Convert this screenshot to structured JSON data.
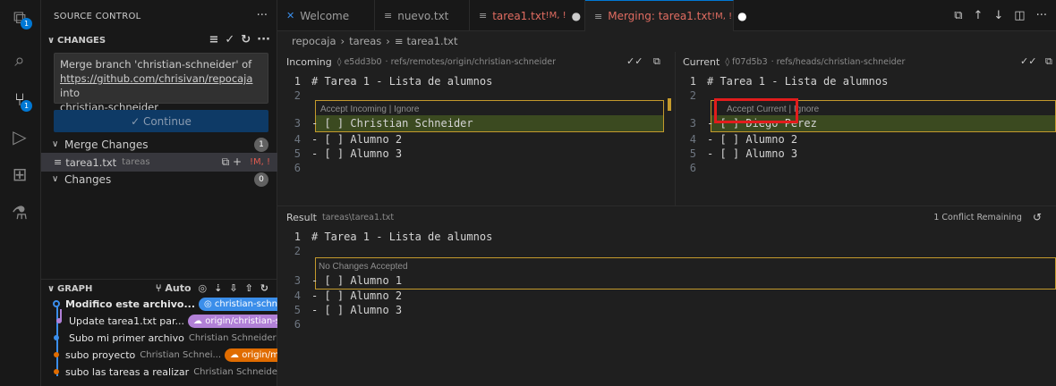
{
  "activity_bar": {
    "explorer_badge": "1",
    "scm_badge": "1"
  },
  "sidebar": {
    "title": "SOURCE CONTROL",
    "more": "···",
    "changes_header": "CHANGES",
    "commit_message_line1": "Merge branch 'christian-schneider' of",
    "commit_message_link": "https://github.com/chrisivan/repocaja",
    "commit_message_line2": "into",
    "commit_message_line3": "christian-schneider",
    "continue_label": "✓ Continue",
    "merge_changes": {
      "label": "Merge Changes",
      "count": "1"
    },
    "merge_file": {
      "name": "tarea1.txt",
      "dir": "tareas",
      "status": "!M, !"
    },
    "changes": {
      "label": "Changes",
      "count": "0"
    }
  },
  "graph": {
    "header": "GRAPH",
    "auto_label": "Auto",
    "commits": [
      {
        "message": "Modifico este archivo...",
        "ref": "christian-schneid...",
        "ref_color": "#3b8eea"
      },
      {
        "message": "Update tarea1.txt par...",
        "ref": "origin/christian-s...",
        "ref_color": "#b180d7"
      },
      {
        "message": "Subo mi primer archivo",
        "author": "Christian Schneider"
      },
      {
        "message": "subo proyecto",
        "author": "Christian Schnei...",
        "ref": "origin/main",
        "ref_color": "#e06c00"
      },
      {
        "message": "subo las tareas a realizar",
        "author": "Christian Schneider"
      }
    ]
  },
  "tabs": [
    {
      "label": "Welcome",
      "icon": "vscode-icon"
    },
    {
      "label": "nuevo.txt",
      "icon": "file-text-icon"
    },
    {
      "label": "tarea1.txt",
      "status": " !M, !",
      "dirty": "●",
      "icon": "file-text-icon"
    },
    {
      "label": "Merging: tarea1.txt",
      "status": " !M, !",
      "dirty": "●",
      "icon": "file-text-icon"
    }
  ],
  "breadcrumb": {
    "folder1": "repocaja",
    "folder2": "tareas",
    "file": "tarea1.txt"
  },
  "incoming": {
    "label": "Incoming",
    "hash": "◊ e5dd3b0",
    "ref": "· refs/remotes/origin/christian-schneider",
    "lens": "Accept Incoming | Ignore",
    "lines": [
      {
        "n": "1",
        "t": "# Tarea 1 - Lista de alumnos"
      },
      {
        "n": "2",
        "t": ""
      },
      {
        "n": "3",
        "t": "- [ ] Christian Schneider"
      },
      {
        "n": "4",
        "t": "- [ ] Alumno 2"
      },
      {
        "n": "5",
        "t": "- [ ] Alumno 3"
      },
      {
        "n": "6",
        "t": ""
      }
    ]
  },
  "current": {
    "label": "Current",
    "hash": "◊ f07d5b3",
    "ref": "· refs/heads/christian-schneider",
    "lens": "Accept Current | Ignore",
    "lines": [
      {
        "n": "1",
        "t": "# Tarea 1 - Lista de alumnos"
      },
      {
        "n": "2",
        "t": ""
      },
      {
        "n": "3",
        "t": "- [ ] Diego Perez"
      },
      {
        "n": "4",
        "t": "- [ ] Alumno 2"
      },
      {
        "n": "5",
        "t": "- [ ] Alumno 3"
      },
      {
        "n": "6",
        "t": ""
      }
    ]
  },
  "result": {
    "label": "Result",
    "path": "tareas\\tarea1.txt",
    "conflicts": "1 Conflict Remaining",
    "lens": "No Changes Accepted",
    "lines": [
      {
        "n": "1",
        "t": "# Tarea 1 - Lista de alumnos"
      },
      {
        "n": "2",
        "t": ""
      },
      {
        "n": "3",
        "t": "- [ ] Alumno 1"
      },
      {
        "n": "4",
        "t": "- [ ] Alumno 2"
      },
      {
        "n": "5",
        "t": "- [ ] Alumno 3"
      },
      {
        "n": "6",
        "t": ""
      }
    ]
  }
}
